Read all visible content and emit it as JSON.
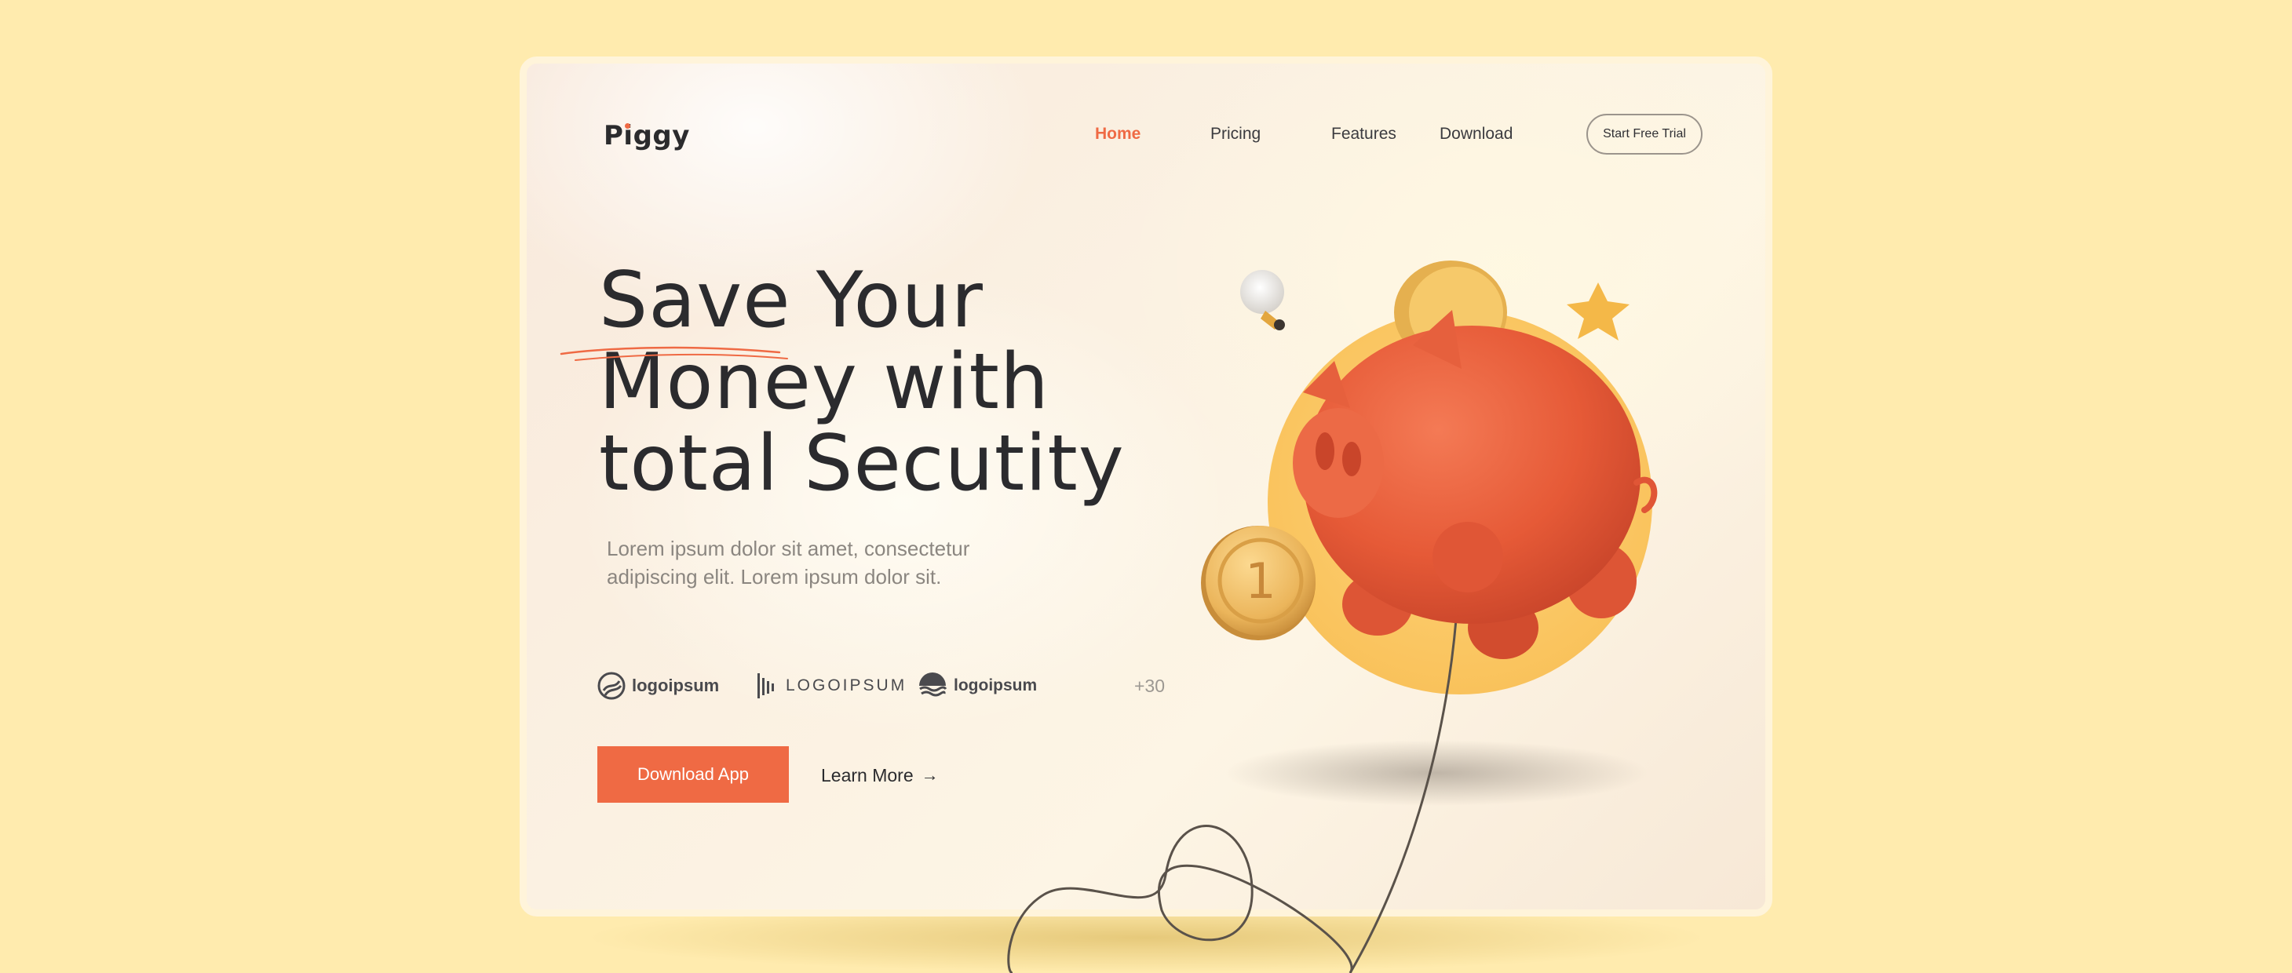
{
  "brand": {
    "name": "Piggy"
  },
  "nav": {
    "items": [
      {
        "label": "Home",
        "active": true
      },
      {
        "label": "Pricing",
        "active": false
      },
      {
        "label": "Features",
        "active": false
      },
      {
        "label": "Download",
        "active": false
      }
    ],
    "cta_label": "Start Free Trial"
  },
  "hero": {
    "headline_lines": [
      "Save Your",
      "Money with",
      "total Secutity"
    ],
    "subtext": "Lorem ipsum dolor sit amet, consectetur adipiscing elit. Lorem ipsum dolor sit.",
    "partners": [
      {
        "label": "logoipsum",
        "icon": "circle-swirl-icon"
      },
      {
        "label": "LOGOIPSUM",
        "icon": "bars-icon"
      },
      {
        "label": "logoipsum",
        "icon": "waves-icon"
      }
    ],
    "partners_more": "+30",
    "primary_button": "Download App",
    "secondary_button": "Learn More",
    "secondary_icon": "arrow-right-icon"
  },
  "illustration": {
    "coin_label": "1",
    "icons": [
      "piggy-bank-icon",
      "coin-icon",
      "star-icon",
      "lightbulb-icon"
    ]
  },
  "colors": {
    "background": "#FFEBAE",
    "accent": "#EF6A44",
    "text_dark": "#2B2B2E",
    "text_muted": "#8B8680",
    "gold": "#F6C75B"
  }
}
